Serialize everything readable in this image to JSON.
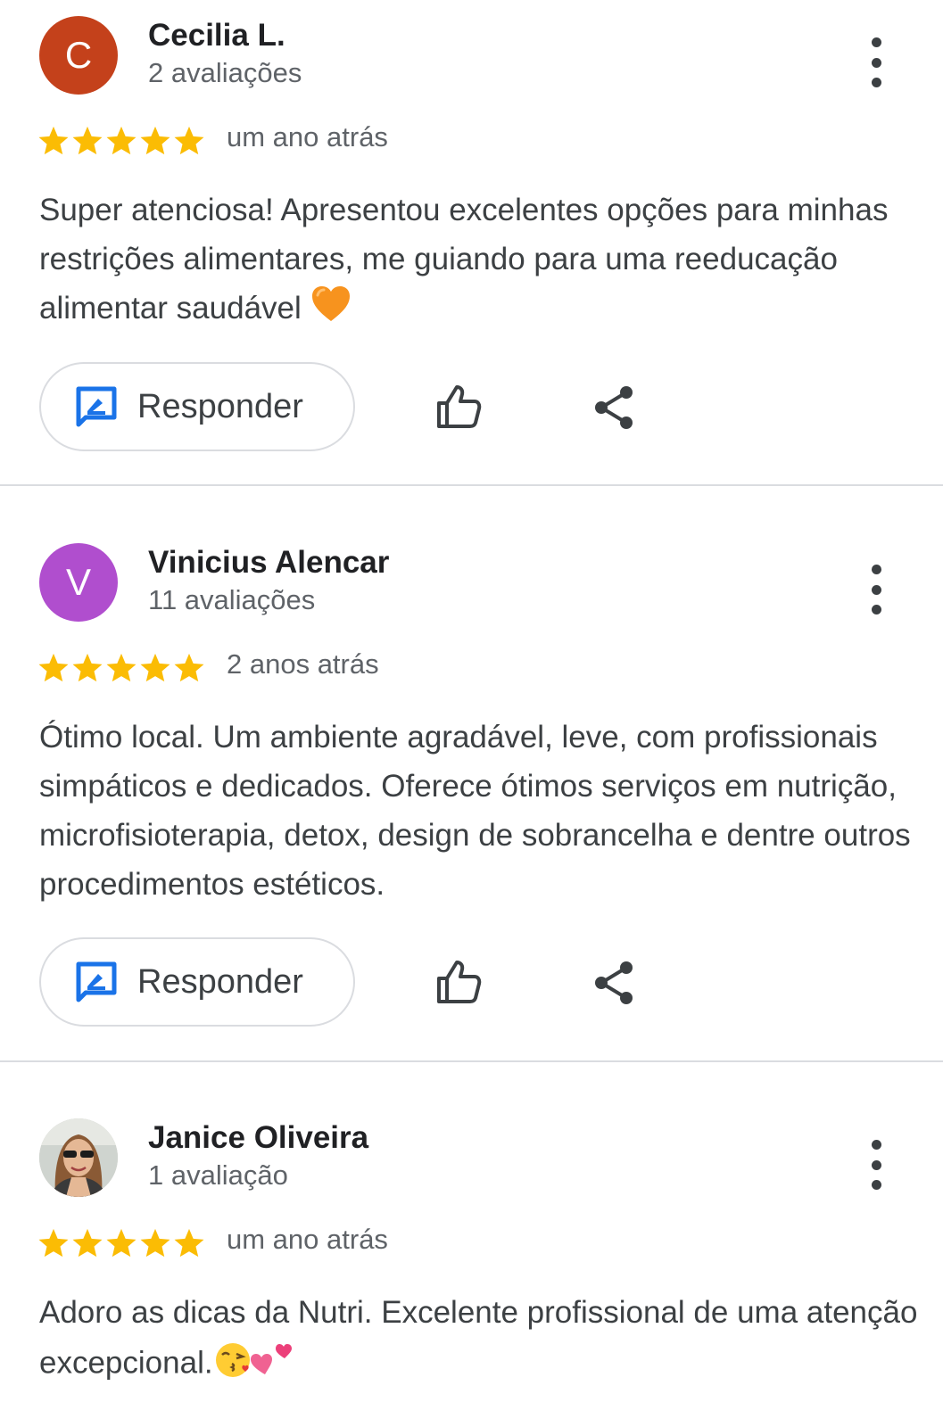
{
  "colors": {
    "star": "#fbbc04",
    "accent_blue": "#1a73e8",
    "avatar_c": "#c4411b",
    "avatar_v": "#b04ece"
  },
  "reviews": [
    {
      "initial": "C",
      "name": "Cecilia L.",
      "count": "2 avaliações",
      "rating": 5,
      "when": "um ano atrás",
      "text": "Super atenciosa! Apresentou excelentes opções para minhas restrições alimentares, me guiando para uma reeducação alimentar saudável",
      "emoji": "orange-heart-icon",
      "reply_label": "Responder"
    },
    {
      "initial": "V",
      "name": "Vinicius Alencar",
      "count": "11 avaliações",
      "rating": 5,
      "when": "2 anos atrás",
      "text": "Ótimo local. Um ambiente agradável, leve, com profissionais simpáticos e dedicados. Oferece ótimos serviços em nutrição, microfisioterapia, detox, design de sobrancelha e dentre outros procedimentos estéticos.",
      "reply_label": "Responder"
    },
    {
      "initial": "",
      "name": "Janice Oliveira",
      "count": "1 avaliação",
      "rating": 5,
      "when": "um ano atrás",
      "text": "Adoro as dicas da Nutri. Excelente profissional de uma atenção excepcional.",
      "emoji": "kiss-and-hearts-icon"
    }
  ]
}
